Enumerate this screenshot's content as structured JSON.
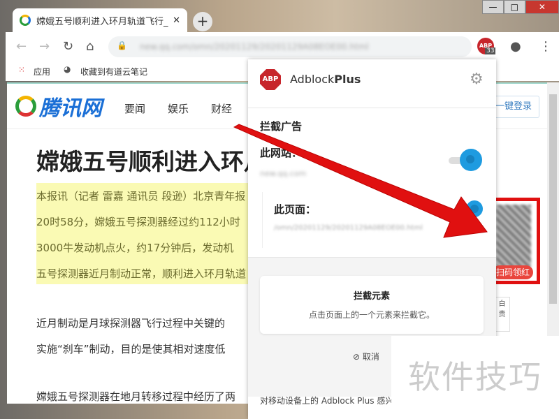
{
  "browser": {
    "tab_title": "嫦娥五号顺利进入环月轨道飞行_",
    "new_tab": "+",
    "url": "new.qq.com/omn/20201129/20201129A08EOE00.html",
    "ext_badge": "33",
    "bookmarks": [
      {
        "label": "应用"
      },
      {
        "label": "收藏到有道云笔记"
      }
    ]
  },
  "site": {
    "logo": "腾讯网",
    "nav": [
      "要闻",
      "娱乐",
      "财经"
    ],
    "login": "一键登录",
    "title": "嫦娥五号顺利进入环月轨道飞行",
    "highlight": [
      "本报讯（记者 雷嘉 通讯员 段逊）北京青年报",
      "20时58分，嫦娥五号探测器经过约112小时",
      "3000牛发动机点火，约17分钟后，发动机",
      "五号探测器近月制动正常，顺利进入环月轨道"
    ],
    "paras": [
      "近月制动是月球探测器飞行过程中关键的",
      "实施“刹车”制动，目的是使其相对速度低",
      "嫦娥五号探测器在地月转移过程中经历了两"
    ],
    "side_ad": "扫码领红包",
    "side_btn": "白 责"
  },
  "popup": {
    "brand_abp": "ABP",
    "brand_a": "Adblock",
    "brand_b": "Plus",
    "section": "拦截广告",
    "site_label": "此网站：",
    "site_value": "new.qq.com",
    "page_label": "此页面：",
    "page_value": "/omn/20201129/20201129A08EOE00.html",
    "card_title": "拦截元素",
    "card_desc": "点击页面上的一个元素来拦截它。",
    "cancel": "取消",
    "footer": "对移动设备上的 Adblock Plus 感兴趣？"
  },
  "watermark": "软件技巧",
  "colors": {
    "accent": "#1e9be0",
    "abp_red": "#c7252b",
    "arrow": "#e01010"
  }
}
